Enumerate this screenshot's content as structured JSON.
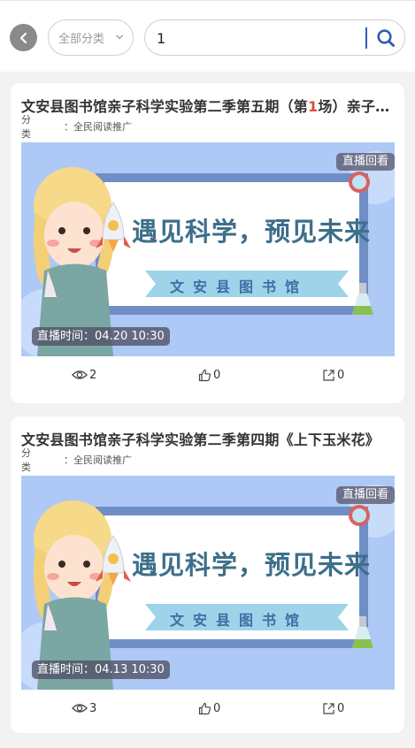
{
  "header": {
    "category_label": "全部分类",
    "search_value": "1"
  },
  "cards": [
    {
      "title_pre": "文安县图书馆亲子科学实验第二季第五期（第",
      "title_hl": "1",
      "title_post": "场）亲子科学实验",
      "category_label": "分类",
      "category_value": "：全民阅读推广",
      "badge": "直播回看",
      "banner_title": "遇见科学，预见未来",
      "banner_sub": "文安县图书馆",
      "live_time": "直播时间：04.20 10:30",
      "views": "2",
      "likes": "0",
      "shares": "0"
    },
    {
      "title_pre": "文安县图书馆亲子科学实验第二季第四期《上下玉米花》",
      "title_hl": "",
      "title_post": "",
      "category_label": "分类",
      "category_value": "：全民阅读推广",
      "badge": "直播回看",
      "banner_title": "遇见科学，预见未来",
      "banner_sub": "文安县图书馆",
      "live_time": "直播时间：04.13 10:30",
      "views": "3",
      "likes": "0",
      "shares": "0"
    }
  ],
  "colors": {
    "accent": "#2f5db0",
    "highlight": "#e04a3a",
    "banner_bg": "#aec9f5",
    "banner_title": "#3d6f8a",
    "ribbon": "#9ed3ea"
  },
  "icons": {
    "back": "chevron-left-icon",
    "dropdown": "chevron-down-icon",
    "search": "search-icon",
    "views": "eye-icon",
    "likes": "thumbs-up-icon",
    "share": "share-icon"
  }
}
